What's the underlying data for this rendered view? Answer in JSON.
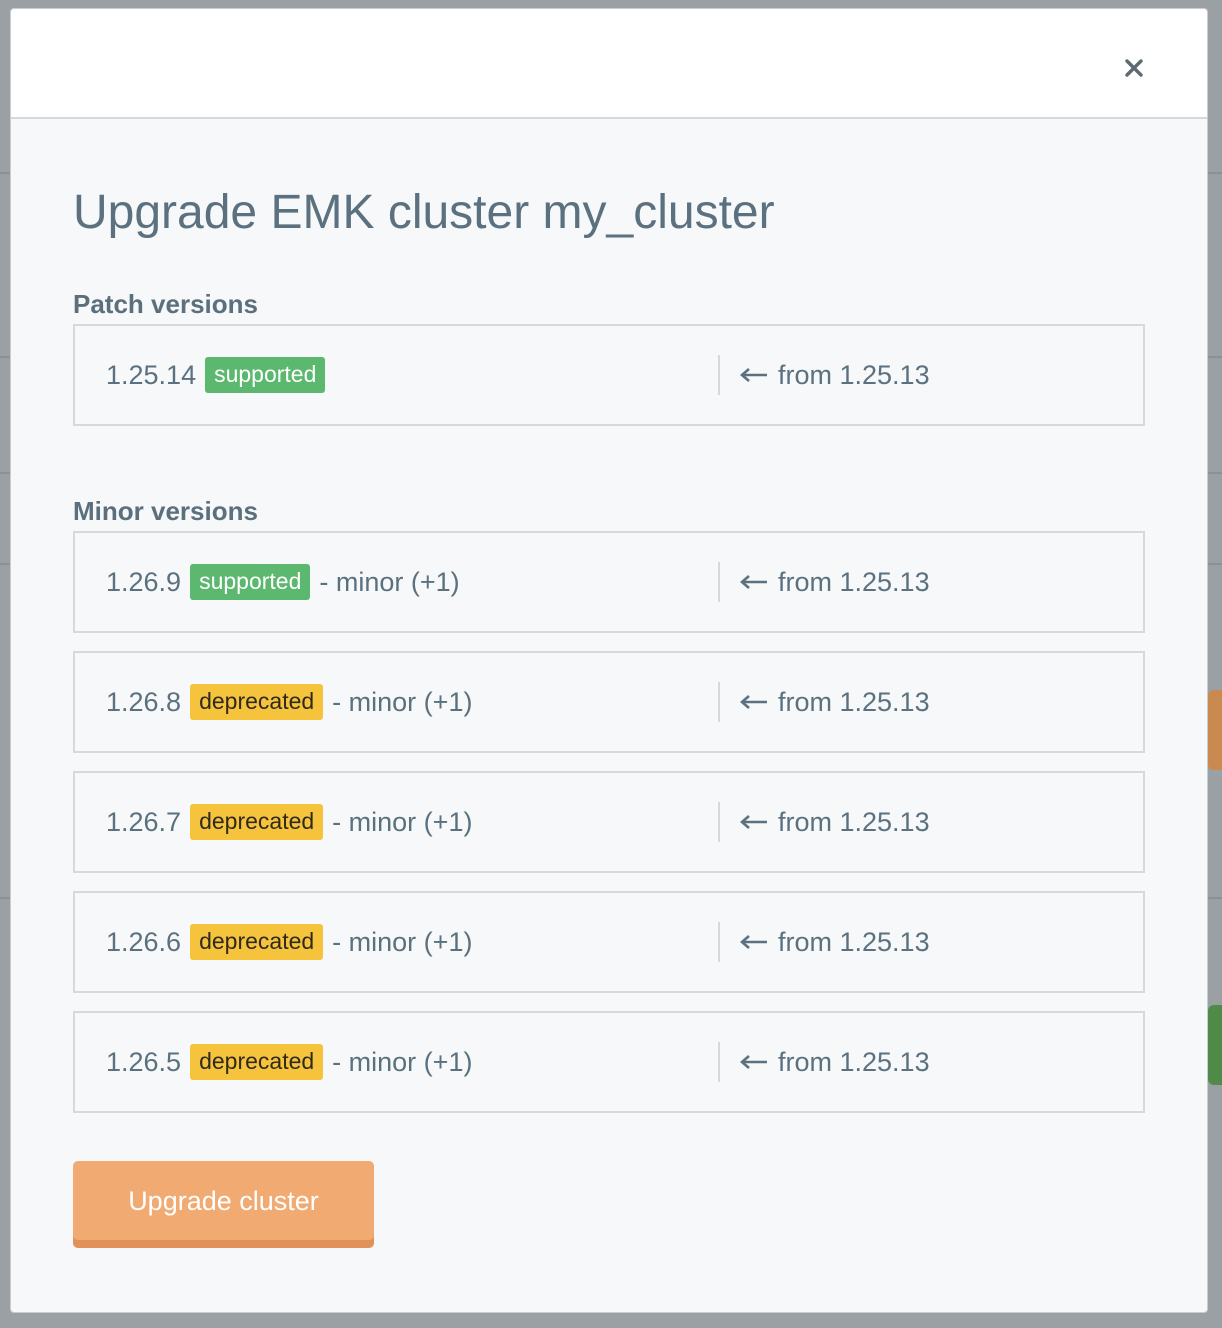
{
  "dialog": {
    "title": "Upgrade EMK cluster my_cluster",
    "close_icon": "close-icon"
  },
  "patch_section": {
    "heading": "Patch versions",
    "versions": [
      {
        "version": "1.25.14",
        "status": "supported",
        "suffix": "",
        "from": "from 1.25.13"
      }
    ]
  },
  "minor_section": {
    "heading": "Minor versions",
    "versions": [
      {
        "version": "1.26.9",
        "status": "supported",
        "suffix": "- minor (+1)",
        "from": "from 1.25.13"
      },
      {
        "version": "1.26.8",
        "status": "deprecated",
        "suffix": "- minor (+1)",
        "from": "from 1.25.13"
      },
      {
        "version": "1.26.7",
        "status": "deprecated",
        "suffix": "- minor (+1)",
        "from": "from 1.25.13"
      },
      {
        "version": "1.26.6",
        "status": "deprecated",
        "suffix": "- minor (+1)",
        "from": "from 1.25.13"
      },
      {
        "version": "1.26.5",
        "status": "deprecated",
        "suffix": "- minor (+1)",
        "from": "from 1.25.13"
      }
    ]
  },
  "actions": {
    "upgrade_label": "Upgrade cluster"
  },
  "colors": {
    "supported": "#5cb86e",
    "deprecated": "#f5c33c",
    "primary_button": "#f0aa72",
    "text": "#5b717f"
  },
  "icons": {
    "row_arrow": "arrow-left-icon"
  }
}
